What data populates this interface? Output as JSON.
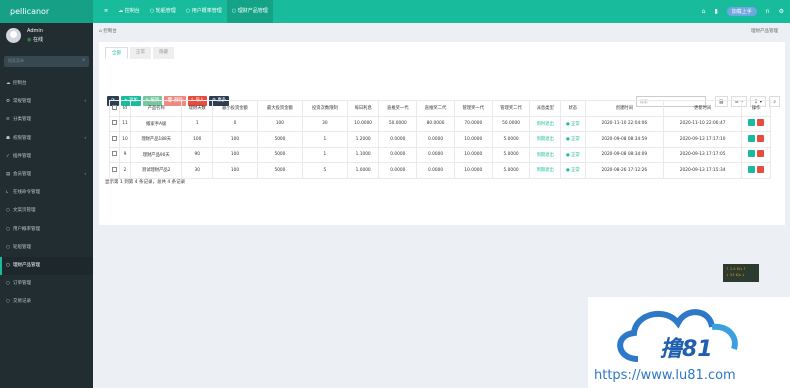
{
  "app": {
    "logo": "pellicanor",
    "nav": [
      {
        "icon": "≡",
        "label": ""
      },
      {
        "icon": "☁",
        "label": "控制台"
      },
      {
        "icon": "○",
        "label": "轮船管理"
      },
      {
        "icon": "○",
        "label": "用户概率管理"
      },
      {
        "icon": "○",
        "label": "理财产品管理"
      }
    ],
    "top_right": {
      "home_icon": "⌂",
      "doc_icon": "▮",
      "cloud_label": "加载上手",
      "extra": "n",
      "settings_icon": "⚙"
    }
  },
  "sidebar": {
    "user_name": "Admin",
    "user_status": "在线",
    "status_dot": "●",
    "search_placeholder": "搜索菜单",
    "search_icon": "⌕",
    "items": [
      {
        "icon": "☁",
        "label": "控制台",
        "arrow": ""
      },
      {
        "icon": "⚙",
        "label": "常规管理",
        "arrow": "‹"
      },
      {
        "icon": "≡",
        "label": "分类管理",
        "arrow": ""
      },
      {
        "icon": "☗",
        "label": "权限管理",
        "arrow": "‹"
      },
      {
        "icon": "✓",
        "label": "插件管理",
        "arrow": ""
      },
      {
        "icon": "▤",
        "label": "会员管理",
        "arrow": "‹"
      },
      {
        "icon": "ւ",
        "label": "在线命令管理",
        "arrow": ""
      },
      {
        "icon": "○",
        "label": "文案页管理",
        "arrow": ""
      },
      {
        "icon": "○",
        "label": "用户概率管理",
        "arrow": ""
      },
      {
        "icon": "○",
        "label": "轮船管理",
        "arrow": ""
      },
      {
        "icon": "○",
        "label": "理财产品管理",
        "arrow": ""
      },
      {
        "icon": "○",
        "label": "订单管理",
        "arrow": ""
      },
      {
        "icon": "○",
        "label": "交易记录",
        "arrow": ""
      }
    ]
  },
  "content": {
    "breadcrumb": "控制台",
    "breadcrumb_icon": "⌂",
    "breadcrumb_right": "理财产品管理",
    "tabs": [
      "全部",
      "正常",
      "隐藏"
    ],
    "toolbar": {
      "refresh": "⟳",
      "add": "+ 添加",
      "edit": "✎ 编辑",
      "delete": "🗑 删除",
      "import": "⇪ 导入",
      "more": "⚙ 更多"
    },
    "search_placeholder": "搜索",
    "right_tools": [
      "▥",
      "≡ ▾",
      "⇩ ▾",
      "⌕"
    ],
    "table": {
      "headers": [
        "",
        "Id",
        "产品名称",
        "理财天数",
        "最小投资金额",
        "最大投资金额",
        "投资次数限制",
        "每日利息",
        "直推奖一代",
        "直推奖二代",
        "管理奖一代",
        "管理奖二代",
        "派息类型",
        "状态",
        "创建时间",
        "更新时间",
        "操作"
      ],
      "rows": [
        [
          "",
          "11",
          "搬家手A级",
          "1",
          "0",
          "100",
          "30",
          "10.0000",
          "50.0000",
          "80.0000",
          "70.0000",
          "50.0000",
          "到时退出",
          "正常",
          "2020-11-10 22:04:06",
          "2020-11-10 22:06:47"
        ],
        [
          "",
          "10",
          "理财产品188天",
          "100",
          "100",
          "5000",
          "1",
          "1.2000",
          "0.0000",
          "0.0000",
          "10.0000",
          "5.0000",
          "到期退出",
          "正常",
          "2020-09-08 08:34:59",
          "2020-09-13 17:17:10"
        ],
        [
          "",
          "9",
          "理财产品90天",
          "90",
          "100",
          "5000",
          "1",
          "1.1000",
          "0.0000",
          "0.0000",
          "10.0000",
          "5.0000",
          "到期退出",
          "正常",
          "2020-09-08 08:34:09",
          "2020-09-13 17:17:05"
        ],
        [
          "",
          "2",
          "测试理财产品2",
          "30",
          "100",
          "5000",
          "5",
          "1.0000",
          "0.0000",
          "0.0000",
          "10.0000",
          "5.0000",
          "到期退出",
          "正常",
          "2020-08-26 17:12:26",
          "2020-09-13 17:15:34"
        ]
      ]
    },
    "footer": "显示第 1 到第 4 条记录，总共 4 条记录"
  },
  "widget": {
    "line1": "↑ 2.4 K/s ↑",
    "line2": "↓ 53 K/s ↓"
  },
  "watermark": {
    "logo_text": "撸81",
    "url": "https://www.lu81.com"
  },
  "colors": {
    "primary": "#18bc9c",
    "sidebar": "#222d32",
    "danger": "#e74c3c",
    "dark": "#2c3e50"
  }
}
